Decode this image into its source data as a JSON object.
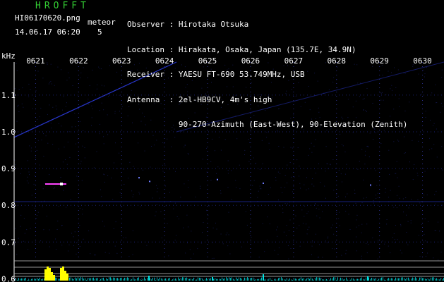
{
  "header": {
    "app_title": "HROFFT",
    "filename": "HI06170620.png",
    "meteor_label": "meteor",
    "datetime": "14.06.17 06:20",
    "meteor_count": "5"
  },
  "station": {
    "rows": [
      {
        "label": "Observer",
        "value": "Hirotaka Otsuka"
      },
      {
        "label": "Location",
        "value": "Hirakata, Osaka, Japan (135.7E, 34.9N)"
      },
      {
        "label": "Receiver",
        "value": "YAESU FT-690 53.749MHz, USB"
      },
      {
        "label": "Antenna",
        "value": "2el-HB9CV, 4m's high"
      },
      {
        "label": "",
        "value": "90-270-Azimuth (East-West), 90-Elevation (Zenith)"
      }
    ]
  },
  "chart_data": {
    "type": "heatmap",
    "ylabel": "kHz",
    "x_ticks": [
      "0621",
      "0622",
      "0623",
      "0624",
      "0625",
      "0626",
      "0627",
      "0628",
      "0629",
      "0630"
    ],
    "y_ticks": [
      1.1,
      1.0,
      0.9,
      0.8,
      0.7,
      0.6
    ],
    "ylim": [
      0.595,
      1.19
    ],
    "colors": {
      "background": "#000000",
      "axis": "#ffffff",
      "signal": "#3344ff",
      "meteor_echo": "#ff44ff",
      "histogram_peak": "#ffff00",
      "histogram_low": "#00e5e5"
    }
  }
}
